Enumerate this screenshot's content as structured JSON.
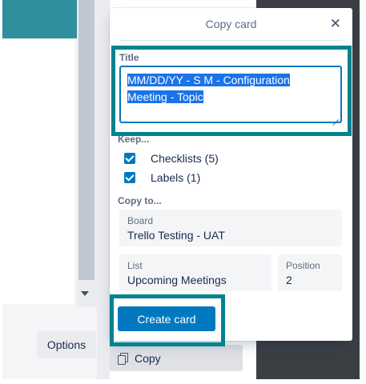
{
  "background": {
    "options_label": "Options",
    "copy_label": "Copy"
  },
  "popover": {
    "title": "Copy card",
    "close_glyph": "✕",
    "title_section_label": "Title",
    "title_value_line1": "MM/DD/YY - S M - Configuration",
    "title_value_line2": "Meeting - Topic",
    "keep_label": "Keep...",
    "keep_items": [
      {
        "label": "Checklists (5)",
        "checked": true
      },
      {
        "label": "Labels (1)",
        "checked": true
      }
    ],
    "copy_to_label": "Copy to...",
    "board": {
      "label": "Board",
      "value": "Trello Testing - UAT"
    },
    "list": {
      "label": "List",
      "value": "Upcoming Meetings"
    },
    "position": {
      "label": "Position",
      "value": "2"
    },
    "create_button_label": "Create card"
  },
  "colors": {
    "accent": "#0079bf",
    "highlight": "#00838f",
    "teal": "#2f8f9d"
  }
}
